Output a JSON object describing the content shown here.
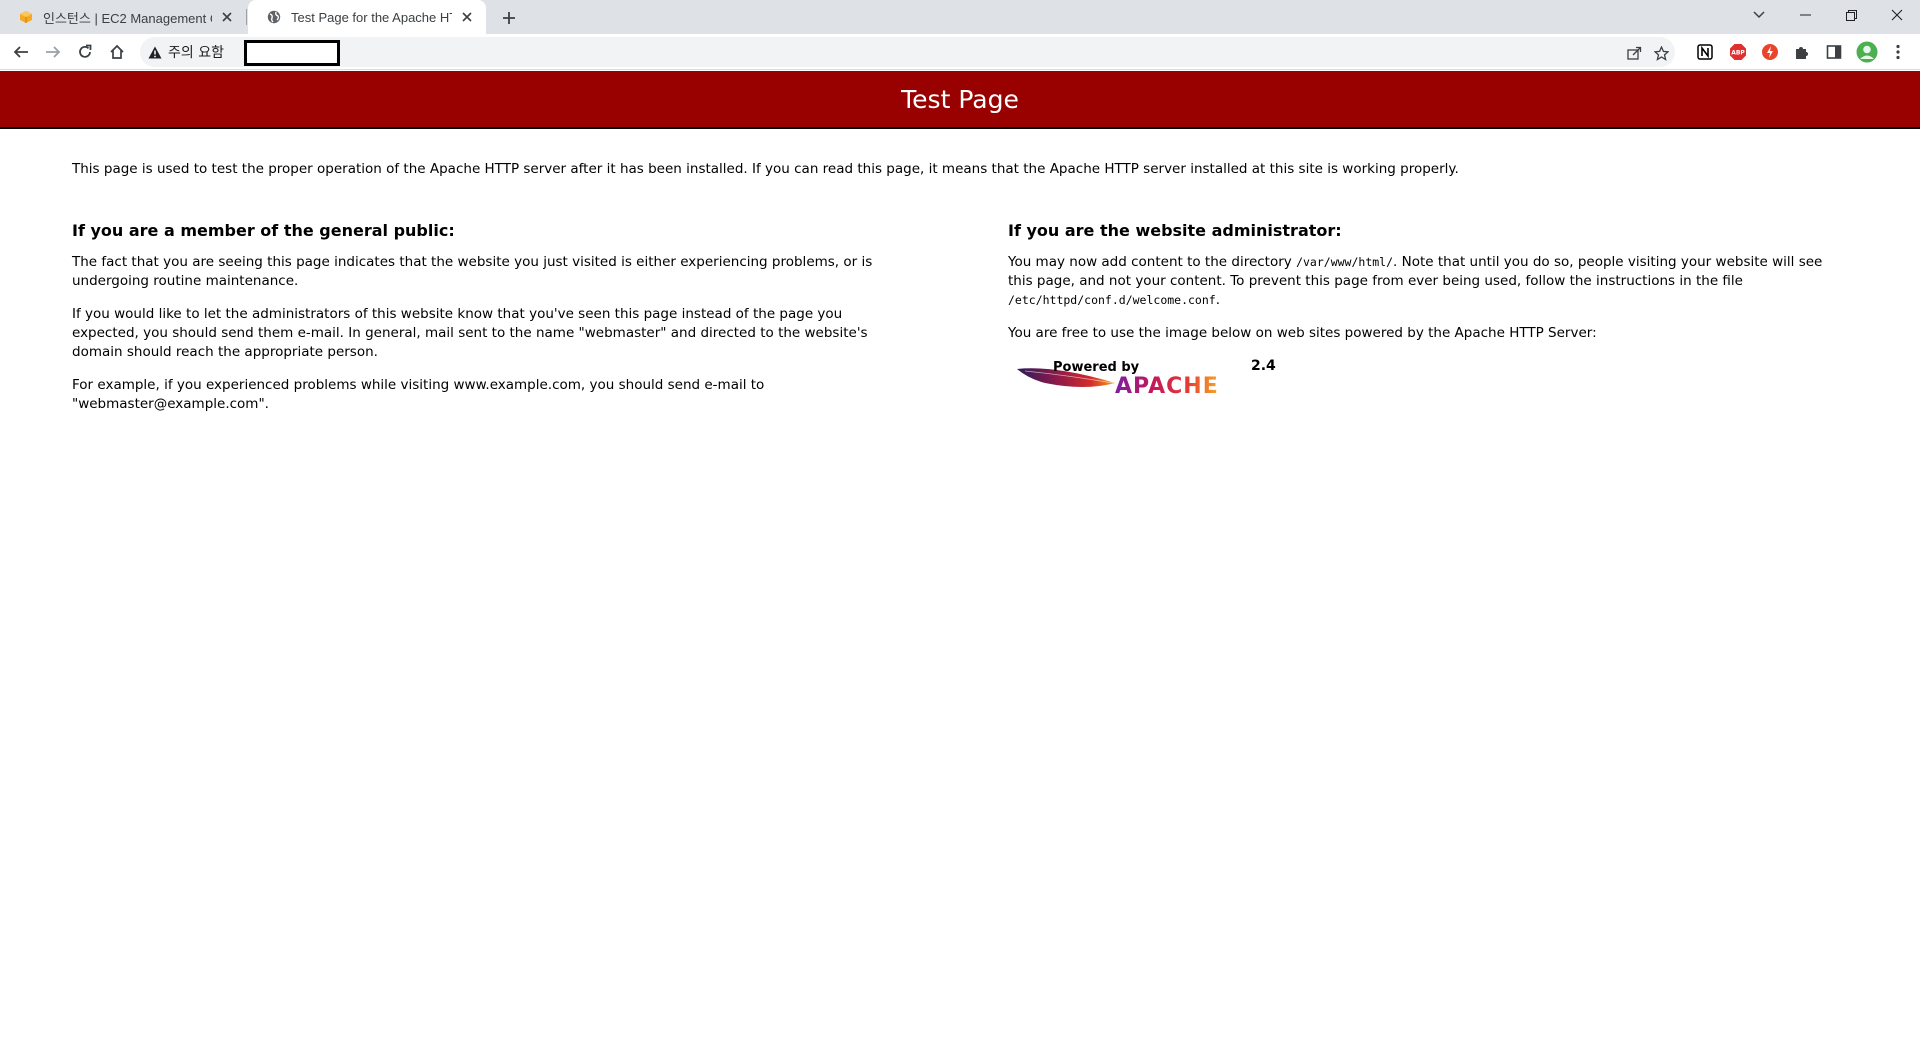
{
  "browser": {
    "tabs": [
      {
        "title": "인스턴스 | EC2 Management Co",
        "active": false,
        "favicon": "aws-cube-icon"
      },
      {
        "title": "Test Page for the Apache HTTP",
        "active": true,
        "favicon": "globe-icon"
      }
    ],
    "security_label": "주의 요함",
    "accent": "#dee1e6"
  },
  "page": {
    "banner_title": "Test Page",
    "banner_color": "#990000",
    "intro": "This page is used to test the proper operation of the Apache HTTP server after it has been installed. If you can read this page, it means that the Apache HTTP server installed at this site is working properly.",
    "left": {
      "heading": "If you are a member of the general public:",
      "p1": "The fact that you are seeing this page indicates that the website you just visited is either experiencing problems, or is undergoing routine maintenance.",
      "p2": "If you would like to let the administrators of this website know that you've seen this page instead of the page you expected, you should send them e-mail. In general, mail sent to the name \"webmaster\" and directed to the website's domain should reach the appropriate person.",
      "p3": "For example, if you experienced problems while visiting www.example.com, you should send e-mail to \"webmaster@example.com\"."
    },
    "right": {
      "heading": "If you are the website administrator:",
      "p1_a": "You may now add content to the directory ",
      "p1_dir": "/var/www/html/",
      "p1_b": ". Note that until you do so, people visiting your website will see this page, and not your content. To prevent this page from ever being used, follow the instructions in the file ",
      "p1_file": "/etc/httpd/conf.d/welcome.conf",
      "p1_c": ".",
      "p2": "You are free to use the image below on web sites powered by the Apache HTTP Server:",
      "logo": {
        "powered_by": "Powered by",
        "version": "2.4",
        "name": "APACHE"
      }
    }
  }
}
